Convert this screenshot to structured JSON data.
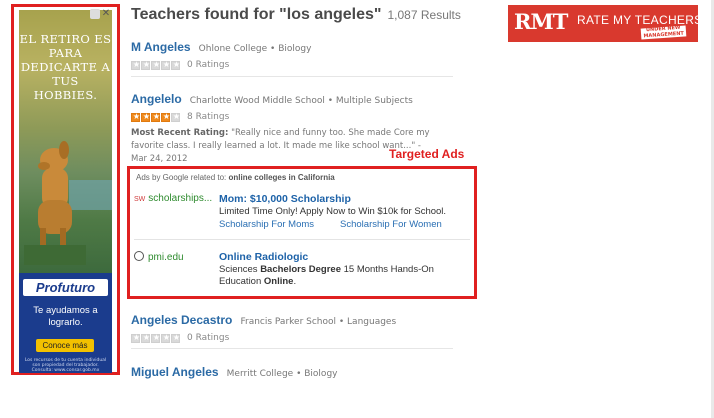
{
  "left_ad": {
    "headline": "EL RETIRO ES PARA DEDICARTE A TUS HOBBIES.",
    "close_glyph": "✕",
    "brand": "Profuturo",
    "tagline": "Te ayudamos a lograrlo.",
    "cta": "Conoce más",
    "fine_print": "Los recursos de tu cuenta individual son propiedad del trabajador. Consulta: www.consar.gob.mx"
  },
  "results": {
    "title": "Teachers found for \"los angeles\"",
    "count": "1,087 Results"
  },
  "teachers": [
    {
      "name": "M Angeles",
      "school": "Ohlone College",
      "subject": "Biology",
      "ratings": "0 Ratings",
      "stars": 0
    },
    {
      "name": "Angelelo",
      "school": "Charlotte Wood Middle School",
      "subject": "Multiple Subjects",
      "ratings": "8 Ratings",
      "stars": 4,
      "recent_label": "Most Recent Rating:",
      "recent_text": "\"Really nice and funny too. She made Core my favorite class. I really learned a lot. It made me like school want...\"",
      "recent_date": "Mar 24, 2012"
    },
    {
      "name": "Angeles Decastro",
      "school": "Francis Parker School",
      "subject": "Languages",
      "ratings": "0 Ratings",
      "stars": 0
    },
    {
      "name": "Miguel Angeles",
      "school": "Merritt College",
      "subject": "Biology",
      "ratings": "",
      "stars": 0
    }
  ],
  "ads": {
    "header_prefix": "Ads by Google related to:",
    "header_topic": "online colleges in California",
    "items": [
      {
        "source": "scholarships...",
        "title": "Mom: $10,000 Scholarship",
        "desc": "Limited Time Only! Apply Now to Win $10k for School.",
        "links": [
          "Scholarship For Moms",
          "Scholarship For Women"
        ]
      },
      {
        "source": "pmi.edu",
        "title": "Online Radiologic",
        "desc_pre": "Sciences ",
        "desc_bold1": "Bachelors Degree",
        "desc_mid": " 15 Months Hands-On Education ",
        "desc_bold2": "Online",
        "desc_end": "."
      }
    ]
  },
  "annotation": {
    "targeted_ads": "Targeted Ads"
  },
  "logo": {
    "mark": "RMT",
    "text": "RATE MY TEACHERS",
    "stamp": "UNDER NEW MANAGEMENT"
  },
  "colors": {
    "accent_red": "#e02020",
    "link_blue": "#2b6aa5",
    "star_orange": "#f08a1c",
    "logo_red": "#d9392e"
  }
}
